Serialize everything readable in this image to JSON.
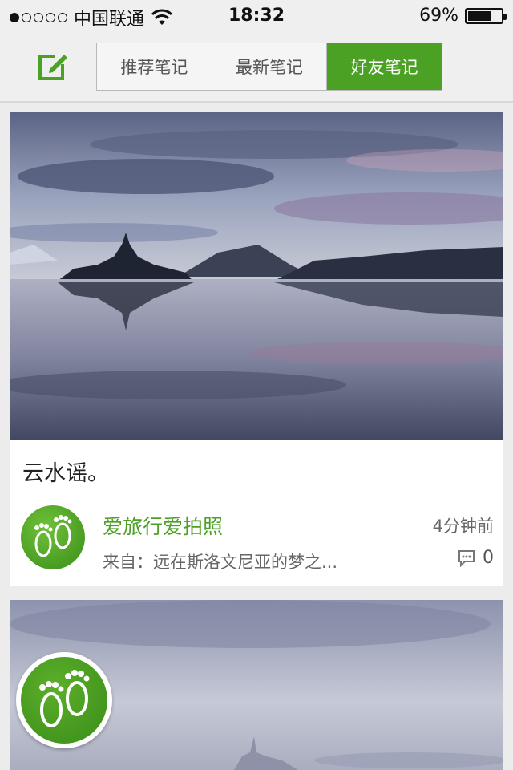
{
  "status_bar": {
    "carrier": "中国联通",
    "time": "18:32",
    "battery": "69%",
    "battery_level": 0.69,
    "signal_bars_filled": 1,
    "signal_bars_total": 5
  },
  "nav": {
    "compose_icon": "compose-icon",
    "tabs": [
      {
        "label": "推荐笔记",
        "active": false
      },
      {
        "label": "最新笔记",
        "active": false
      },
      {
        "label": "好友笔记",
        "active": true
      }
    ]
  },
  "colors": {
    "accent": "#4ba123",
    "background": "#ececec"
  },
  "feed": {
    "cards": [
      {
        "title": "云水谣。",
        "author": "爱旅行爱拍照",
        "time": "4分钟前",
        "source": "来自：远在斯洛文尼亚的梦之...",
        "comment_count": "0",
        "avatar_icon": "footprints-icon",
        "comment_icon": "comment-icon"
      }
    ]
  },
  "floating_button": {
    "icon": "footprints-icon"
  }
}
